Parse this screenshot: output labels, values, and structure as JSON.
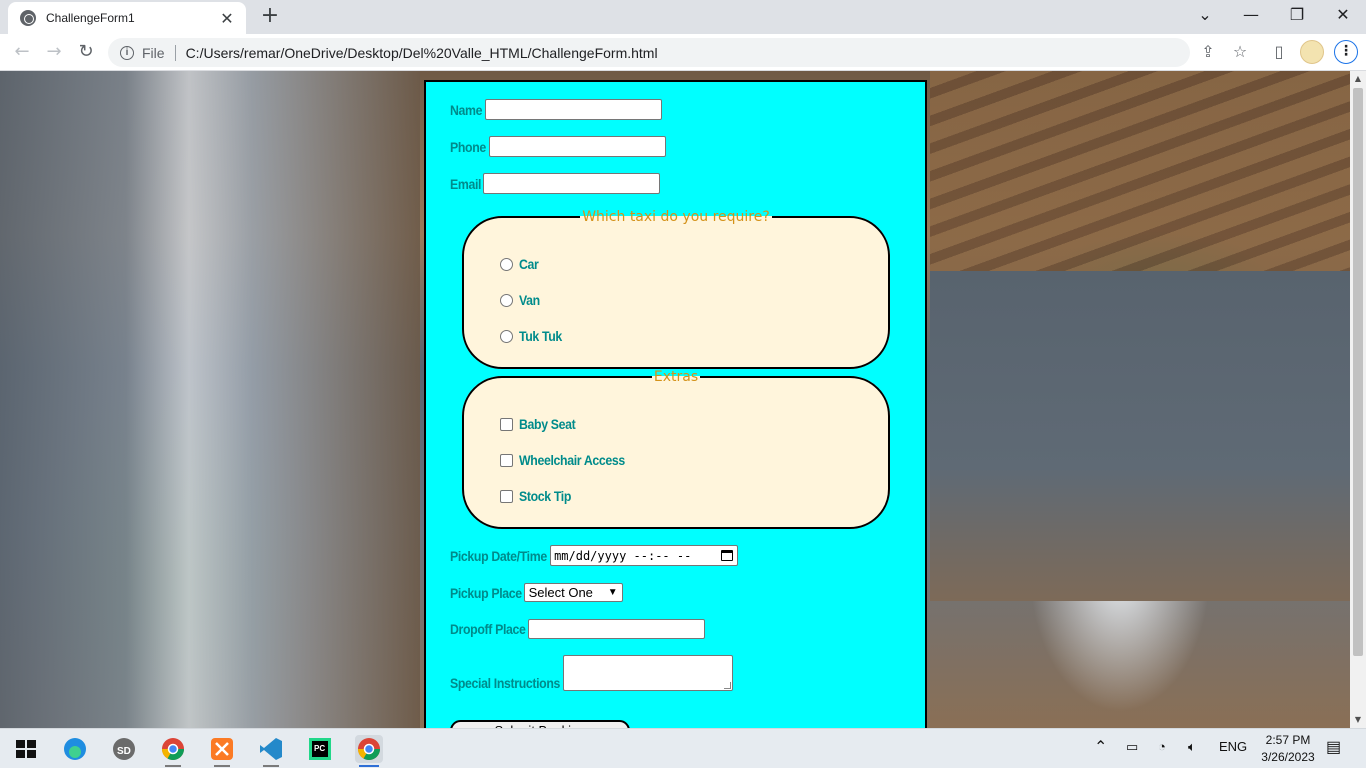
{
  "browser": {
    "tab_title": "ChallengeForm1",
    "new_tab": "+",
    "tab_close": "✕",
    "scheme_label": "File",
    "url": "C:/Users/remar/OneDrive/Desktop/Del%20Valle_HTML/ChallengeForm.html",
    "window_controls": {
      "dropdown": "⌄",
      "minimize": "—",
      "restore": "❐",
      "close": "✕"
    },
    "nav": {
      "back": "←",
      "forward": "→",
      "reload": "↻"
    },
    "icons": {
      "share": "⇪",
      "star": "☆",
      "sidepanel": "▯",
      "menu": "⋮"
    }
  },
  "form": {
    "name_label": "Name",
    "phone_label": "Phone",
    "email_label": "Email",
    "taxi_legend": "Which taxi do you require?",
    "taxi_options": [
      "Car",
      "Van",
      "Tuk Tuk"
    ],
    "extras_legend": "Extras",
    "extras_options": [
      "Baby Seat",
      "Wheelchair Access",
      "Stock Tip"
    ],
    "pickup_datetime_label": "Pickup Date/Time",
    "pickup_datetime_placeholder": "mm/dd/yyyy --:-- --",
    "pickup_place_label": "Pickup Place",
    "pickup_place_selected": "Select One",
    "dropoff_place_label": "Dropoff Place",
    "special_instructions_label": "Special Instructions",
    "submit_label": "Submit Booking"
  },
  "taskbar": {
    "apps": [
      "start",
      "edge",
      "sd",
      "chrome-profile",
      "xampp",
      "vscode",
      "pycharm",
      "chrome"
    ],
    "language": "ENG",
    "time": "2:57 PM",
    "date": "3/26/2023"
  },
  "colors": {
    "form_bg": "#00ffff",
    "label_color": "#008b8b",
    "fieldset_bg": "#fff5dc",
    "legend_color": "#d4921a"
  }
}
